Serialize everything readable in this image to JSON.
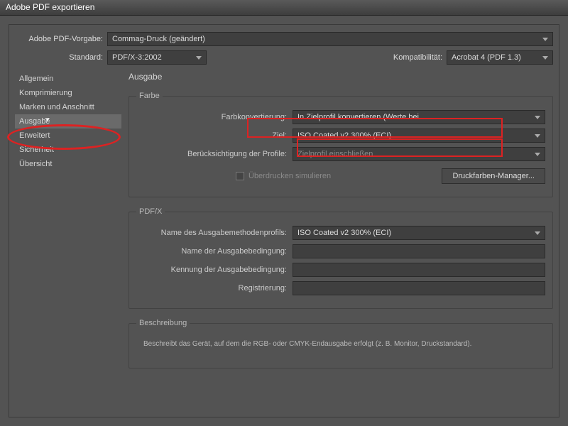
{
  "title": "Adobe PDF exportieren",
  "top": {
    "preset_label": "Adobe PDF-Vorgabe:",
    "preset_value": "Commag-Druck (geändert)",
    "standard_label": "Standard:",
    "standard_value": "PDF/X-3:2002",
    "compat_label": "Kompatibilität:",
    "compat_value": "Acrobat 4 (PDF 1.3)"
  },
  "sidebar": {
    "items": [
      {
        "label": "Allgemein"
      },
      {
        "label": "Komprimierung"
      },
      {
        "label": "Marken und Anschnitt"
      },
      {
        "label": "Ausgabe"
      },
      {
        "label": "Erweitert"
      },
      {
        "label": "Sicherheit"
      },
      {
        "label": "Übersicht"
      }
    ]
  },
  "main": {
    "heading": "Ausgabe",
    "farbe": {
      "legend": "Farbe",
      "conv_label": "Farbkonvertierung:",
      "conv_value": "In Zielprofil konvertieren (Werte bei…",
      "ziel_label": "Ziel:",
      "ziel_value": "ISO Coated v2 300% (ECI)",
      "profile_label": "Berücksichtigung der Profile:",
      "profile_value": "Zielprofil einschließen",
      "overprint_label": "Überdrucken simulieren",
      "ink_mgr_btn": "Druckfarben-Manager..."
    },
    "pdfx": {
      "legend": "PDF/X",
      "out_profile_label": "Name des Ausgabemethodenprofils:",
      "out_profile_value": "ISO Coated v2 300% (ECI)",
      "out_cond_label": "Name der Ausgabebedingung:",
      "out_cond_id_label": "Kennung der Ausgabebedingung:",
      "reg_label": "Registrierung:"
    },
    "desc": {
      "legend": "Beschreibung",
      "text": "Beschreibt das Gerät, auf dem die RGB- oder CMYK-Endausgabe erfolgt (z. B. Monitor, Druckstandard)."
    }
  }
}
